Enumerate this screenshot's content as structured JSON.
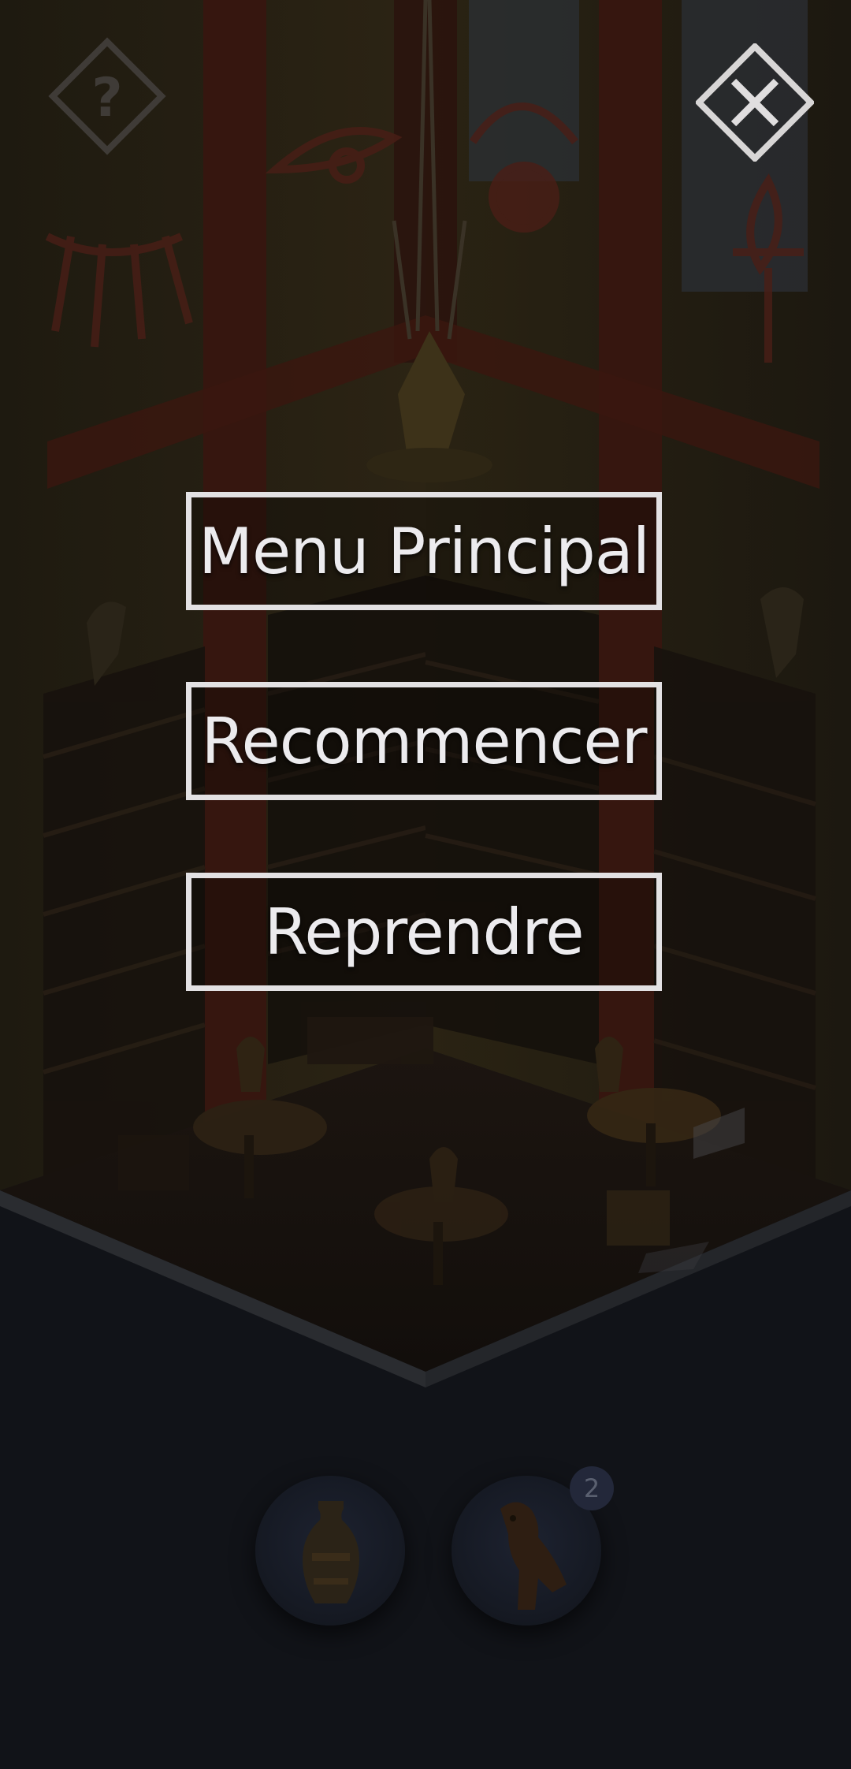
{
  "menu": {
    "main_menu_label": "Menu Principal",
    "restart_label": "Recommencer",
    "resume_label": "Reprendre"
  },
  "top_bar": {
    "help_icon": "question-mark-diamond-icon",
    "close_icon": "close-x-diamond-icon"
  },
  "inventory": {
    "items": [
      {
        "name": "vase",
        "icon": "vase-icon"
      },
      {
        "name": "falcon",
        "icon": "falcon-statue-icon",
        "count": "2"
      }
    ]
  },
  "colors": {
    "button_border": "#e3e1e3",
    "button_text": "#ecebee",
    "background": "#111318"
  }
}
